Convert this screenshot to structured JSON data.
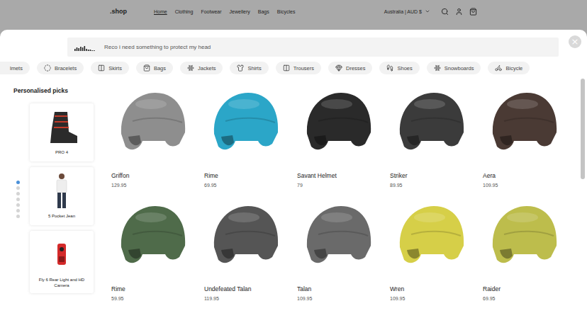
{
  "header": {
    "logo": ".shop",
    "nav": [
      {
        "label": "Home",
        "selected": true
      },
      {
        "label": "Clothing",
        "selected": false
      },
      {
        "label": "Footwear",
        "selected": false
      },
      {
        "label": "Jewellery",
        "selected": false
      },
      {
        "label": "Bags",
        "selected": false
      },
      {
        "label": "Bicycles",
        "selected": false
      }
    ],
    "locale": "Australia | AUD $"
  },
  "search": {
    "query": "Reco i need something to protect my head"
  },
  "close_button": "×",
  "categories": [
    {
      "label": "lmets"
    },
    {
      "label": "Bracelets"
    },
    {
      "label": "Skirts"
    },
    {
      "label": "Bags"
    },
    {
      "label": "Jackets"
    },
    {
      "label": "Shirts"
    },
    {
      "label": "Trousers"
    },
    {
      "label": "Dresses"
    },
    {
      "label": "Shoes"
    },
    {
      "label": "Snowboards"
    },
    {
      "label": "Bicycle"
    }
  ],
  "sidebar": {
    "title": "Personalised picks",
    "pages": [
      {
        "selected": true
      },
      {
        "selected": false
      },
      {
        "selected": false
      },
      {
        "selected": false
      },
      {
        "selected": false
      },
      {
        "selected": false
      },
      {
        "selected": false
      }
    ],
    "items": [
      {
        "name": "PRO 4"
      },
      {
        "name": "5 Pocket Jean"
      },
      {
        "name": "Fly 6 Rear Light and HD Camera"
      }
    ]
  },
  "products": [
    {
      "name": "Griffon",
      "price": "129.95",
      "color": "#8e8e8e"
    },
    {
      "name": "Rime",
      "price": "69.95",
      "color": "#2ba6c8"
    },
    {
      "name": "Savant Helmet",
      "price": "79",
      "color": "#2a2a2a"
    },
    {
      "name": "Striker",
      "price": "89.95",
      "color": "#3b3b3b"
    },
    {
      "name": "Aera",
      "price": "109.95",
      "color": "#4a3a34"
    },
    {
      "name": "Rime",
      "price": "59.95",
      "color": "#4f6b4a"
    },
    {
      "name": "Undefeated Talan",
      "price": "119.95",
      "color": "#555555"
    },
    {
      "name": "Talan",
      "price": "109.95",
      "color": "#6a6a6a"
    },
    {
      "name": "Wren",
      "price": "109.95",
      "color": "#d6cf48"
    },
    {
      "name": "Raider",
      "price": "69.95",
      "color": "#bdbd4c"
    }
  ],
  "scroll": {
    "level": 0.4
  }
}
